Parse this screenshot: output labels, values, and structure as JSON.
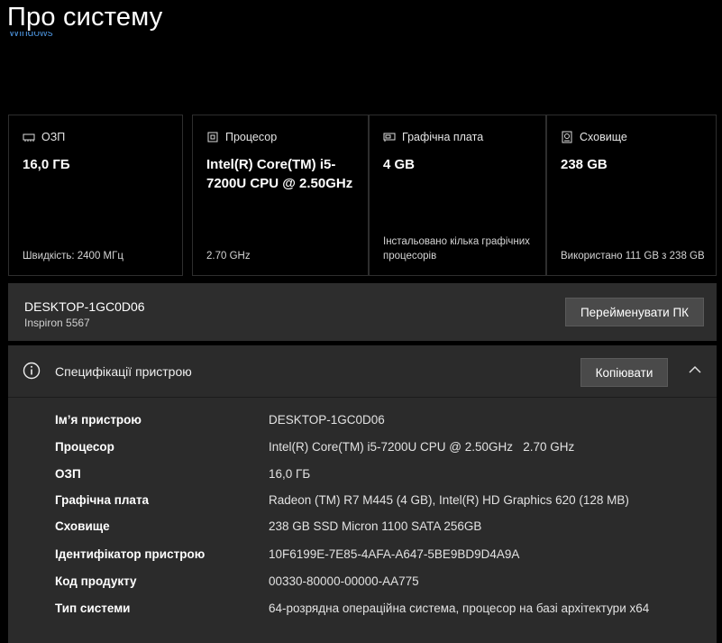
{
  "page": {
    "title": "Про систему",
    "cut_off_text": "Windows"
  },
  "cards": [
    {
      "icon": "ram-icon",
      "label": "ОЗП",
      "value": "16,0 ГБ",
      "footer": "Швидкість: 2400 МГц"
    },
    {
      "icon": "cpu-icon",
      "label": "Процесор",
      "value": "Intel(R) Core(TM) i5-7200U CPU @ 2.50GHz",
      "footer": "2.70 GHz"
    },
    {
      "icon": "gpu-icon",
      "label": "Графічна плата",
      "value": "4 GB",
      "footer": "Інстальовано кілька графічних процесорів"
    },
    {
      "icon": "storage-icon",
      "label": "Сховище",
      "value": "238 GB",
      "footer": "Використано 111 GB з 238 GB"
    }
  ],
  "pc": {
    "name": "DESKTOP-1GC0D06",
    "model": "Inspiron 5567",
    "rename_label": "Перейменувати ПК"
  },
  "specs": {
    "title": "Специфікації пристрою",
    "copy_label": "Копіювати",
    "rows": [
      {
        "key": "Ім’я пристрою",
        "value": "DESKTOP-1GC0D06"
      },
      {
        "key": "Процесор",
        "value": "Intel(R) Core(TM) i5-7200U CPU @ 2.50GHz   2.70 GHz"
      },
      {
        "key": "ОЗП",
        "value": "16,0 ГБ"
      },
      {
        "key": "Графічна плата",
        "value": "Radeon (TM) R7 M445 (4 GB), Intel(R) HD Graphics 620 (128 MB)"
      },
      {
        "key": "Сховище",
        "value": "238 GB SSD Micron 1100 SATA 256GB"
      },
      {
        "key": "Ідентифікатор пристрою",
        "value": "10F6199E-7E85-4AFA-A647-5BE9BD9D4A9A"
      },
      {
        "key": "Код продукту",
        "value": "00330-80000-00000-AA775"
      },
      {
        "key": "Тип системи",
        "value": "64-розрядна операційна система, процесор на базі архітектури x64"
      }
    ]
  },
  "colors": {
    "background": "#000000",
    "panel": "#2b2b2b",
    "button": "#4a4a4a",
    "link_accent": "#4a8fd6"
  }
}
